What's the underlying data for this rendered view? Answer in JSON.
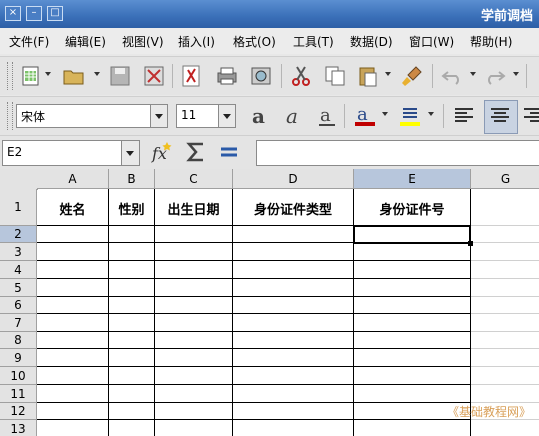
{
  "window": {
    "title": "学前调档"
  },
  "menu": [
    "文件(F)",
    "编辑(E)",
    "视图(V)",
    "插入(I)",
    "格式(O)",
    "工具(T)",
    "数据(D)",
    "窗口(W)",
    "帮助(H)"
  ],
  "format_bar": {
    "font_name": "宋体",
    "font_size": "11"
  },
  "formula_bar": {
    "cell_ref": "E2",
    "content": ""
  },
  "columns": [
    "A",
    "B",
    "C",
    "D",
    "E",
    "G"
  ],
  "selected_column": "E",
  "rows": [
    "1",
    "2",
    "3",
    "4",
    "5",
    "6",
    "7",
    "8",
    "9",
    "10",
    "11",
    "12",
    "13"
  ],
  "selected_row": "2",
  "header_row": [
    "姓名",
    "性别",
    "出生日期",
    "身份证件类型",
    "身份证件号"
  ],
  "watermark": "《基础教程网》",
  "icons": [
    "close-icon",
    "minimize-icon",
    "maximize-icon",
    "new-spreadsheet-icon",
    "open-folder-icon",
    "save-icon",
    "export-icon",
    "pdf-icon",
    "print-icon",
    "print-preview-icon",
    "cut-icon",
    "copy-icon",
    "paste-icon",
    "format-paintbrush-icon",
    "undo-icon",
    "redo-icon",
    "bold-icon",
    "italic-icon",
    "underline-icon",
    "font-color-icon",
    "highlight-icon",
    "align-left-icon",
    "align-center-icon",
    "align-right-icon",
    "function-wizard-icon",
    "sum-icon",
    "equals-icon"
  ],
  "colors": {
    "titlebar": "#3a6fb8",
    "selection_header": "#b7c6dc",
    "font_color": "#c00000",
    "highlight": "#ffff00"
  }
}
